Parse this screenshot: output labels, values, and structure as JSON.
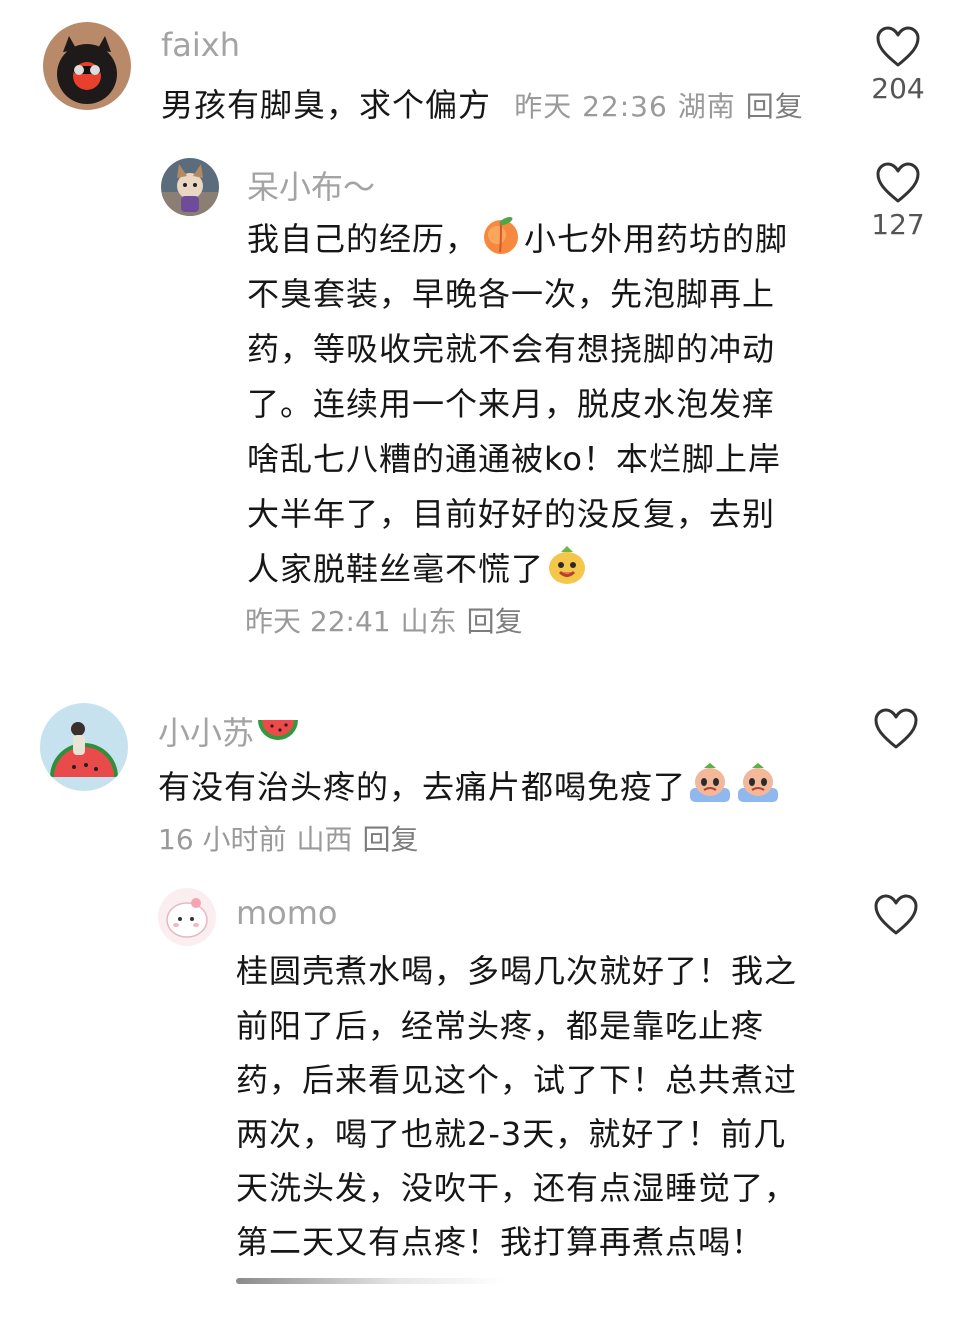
{
  "comments": [
    {
      "username": "faixh",
      "lines": [
        "男孩有脚臭，求个偏方"
      ],
      "time": "昨天 22:36",
      "location": "湖南",
      "reply": "回复",
      "likes": "204"
    },
    {
      "username": "呆小布～",
      "lines": [
        "我自己的经历，",
        "小七外用药坊的脚",
        "不臭套装，早晚各一次，先泡脚再上",
        "药，等吸收完就不会有想挠脚的冲动",
        "了。连续用一个来月，脱皮水泡发痒",
        "啥乱七八糟的通通被ko！本烂脚上岸",
        "大半年了，目前好好的没反复，去别",
        "人家脱鞋丝毫不慌了"
      ],
      "time": "昨天 22:41",
      "location": "山东",
      "reply": "回复",
      "likes": "127"
    },
    {
      "username": "小小苏",
      "lines": [
        "有没有治头疼的，去痛片都喝免疫了"
      ],
      "time": "16 小时前",
      "location": "山西",
      "reply": "回复",
      "likes": ""
    },
    {
      "username": "momo",
      "lines": [
        "桂圆壳煮水喝，多喝几次就好了！我之",
        "前阳了后，经常头疼，都是靠吃止疼",
        "药，后来看见这个，试了下！总共煮过",
        "两次，喝了也就2-3天，就好了！前几",
        "天洗头发，没吹干，还有点湿睡觉了，",
        "第二天又有点疼！我打算再煮点喝！"
      ],
      "likes": ""
    }
  ],
  "colors": {
    "username": "#a3a3a3",
    "meta": "#9a9a9a",
    "text": "#161616"
  },
  "icons": {
    "like": "heart-outline-icon",
    "peach": "peach-emoji-icon",
    "watermelon": "watermelon-emoji-icon",
    "cry": "crying-emoji-icon",
    "happy": "happy-face-emoji-icon"
  }
}
